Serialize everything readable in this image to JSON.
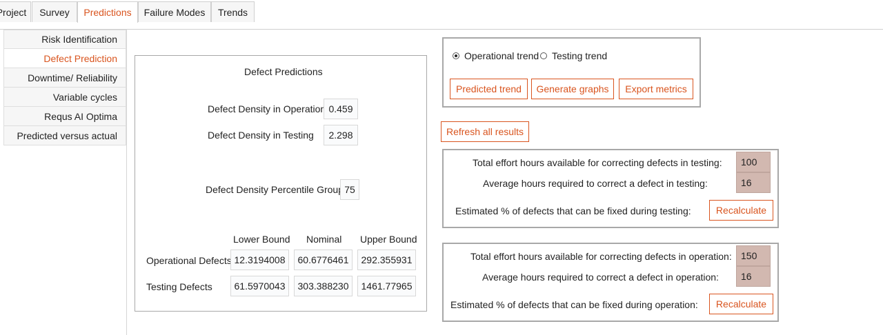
{
  "tabs": [
    {
      "label": "Project"
    },
    {
      "label": "Survey"
    },
    {
      "label": "Predictions"
    },
    {
      "label": "Failure Modes"
    },
    {
      "label": "Trends"
    }
  ],
  "sidebar": {
    "items": [
      {
        "label": "Risk Identification"
      },
      {
        "label": "Defect Prediction"
      },
      {
        "label": "Downtime/ Reliability"
      },
      {
        "label": "Variable cycles"
      },
      {
        "label": "Requs AI Optima"
      },
      {
        "label": "Predicted versus actual"
      }
    ]
  },
  "predictions": {
    "title": "Defect Predictions",
    "density_operation_label": "Defect Density in Operation",
    "density_operation_value": "0.459",
    "density_testing_label": "Defect Density in Testing",
    "density_testing_value": "2.298",
    "percentile_label": "Defect Density Percentile Group",
    "percentile_value": "75",
    "columns": [
      "Lower Bound",
      "Nominal",
      "Upper Bound"
    ],
    "rows": [
      {
        "label": "Operational Defects",
        "values": [
          "12.3194008",
          "60.6776461",
          "292.355931"
        ]
      },
      {
        "label": "Testing Defects",
        "values": [
          "61.5970043",
          "303.388230",
          "1461.77965"
        ]
      }
    ]
  },
  "trend": {
    "operational_label": "Operational trend",
    "testing_label": "Testing trend",
    "selected": "operational",
    "predicted_button": "Predicted trend",
    "graphs_button": "Generate graphs",
    "export_button": "Export metrics"
  },
  "refresh_button": "Refresh all results",
  "testing_effort": {
    "hours_label": "Total effort hours available for correcting defects in testing:",
    "hours_value": "100",
    "avg_label": "Average hours required to correct a defect in testing:",
    "avg_value": "16",
    "estimate_label": "Estimated % of defects that can be fixed during testing:",
    "recalc_button": "Recalculate"
  },
  "operation_effort": {
    "hours_label": "Total effort hours available for correcting defects in operation:",
    "hours_value": "150",
    "avg_label": "Average hours required to correct a defect in operation:",
    "avg_value": "16",
    "estimate_label": "Estimated % of defects that can be fixed during operation:",
    "recalc_button": "Recalculate"
  },
  "colors": {
    "accent": "#d9541e",
    "input_tan": "#d2b8b0"
  }
}
